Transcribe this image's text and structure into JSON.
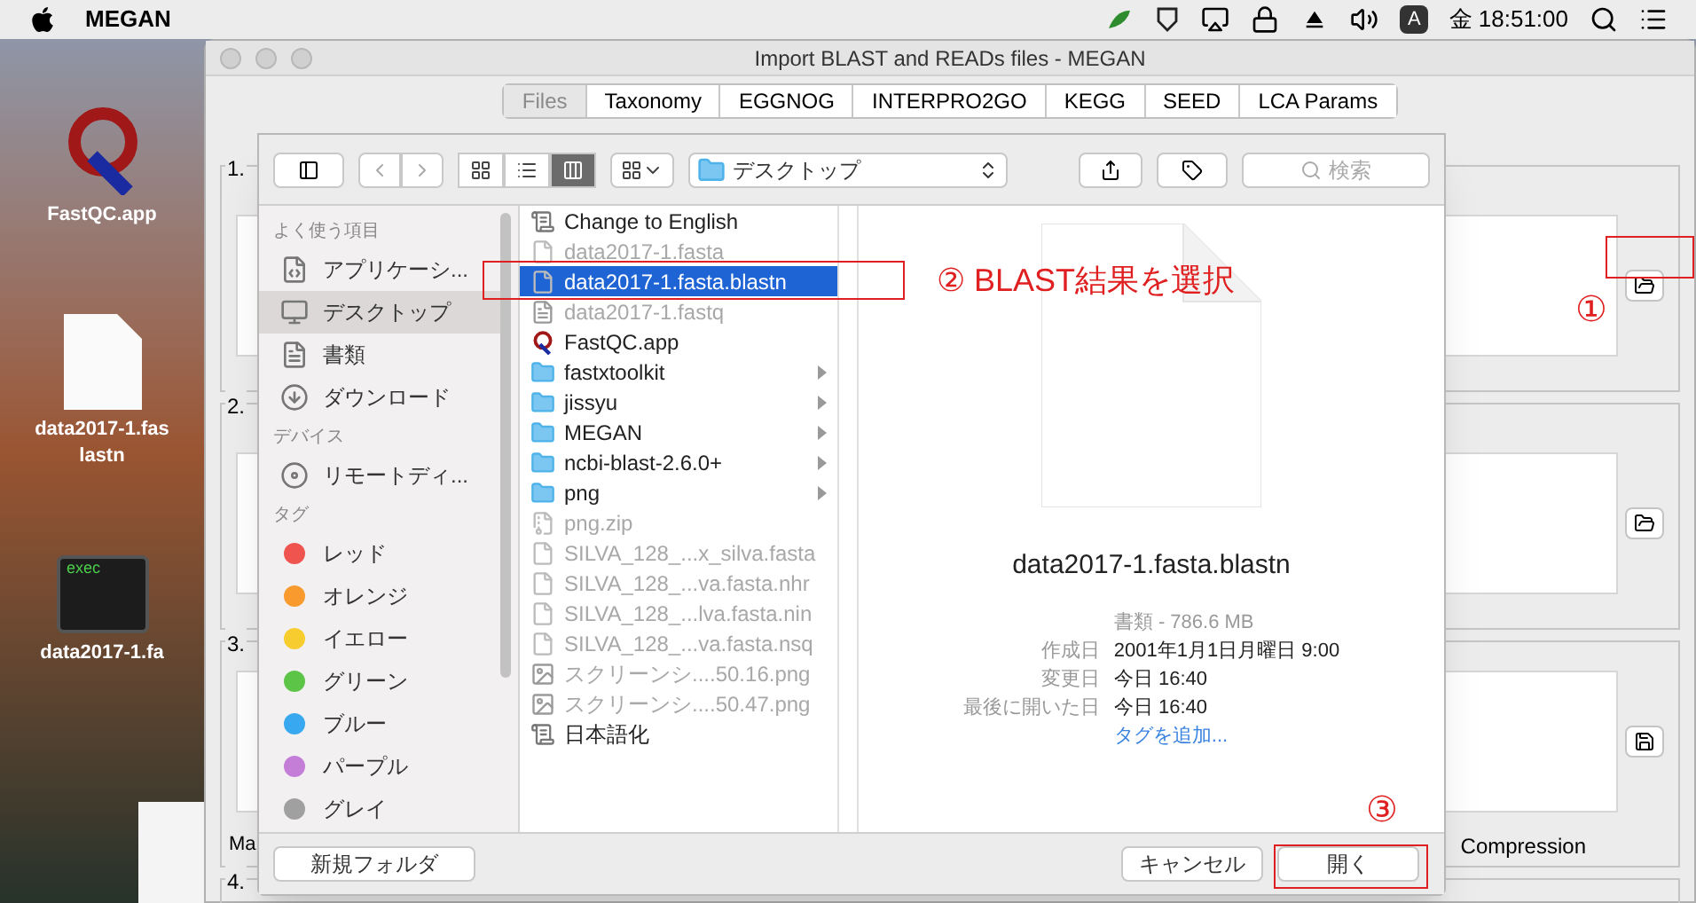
{
  "menu_bar": {
    "app": "MEGAN",
    "input_badge": "A",
    "clock": "金 18:51:00"
  },
  "desktop_icons": [
    {
      "kind": "app",
      "lines": [
        "FastQC.app"
      ]
    },
    {
      "kind": "document",
      "lines": [
        "data2017-1.fas",
        "lastn"
      ]
    },
    {
      "kind": "terminal",
      "badge": "exec",
      "lines": [
        "data2017-1.fa"
      ]
    }
  ],
  "window": {
    "title": "Import BLAST and READs files - MEGAN",
    "tabs": [
      {
        "label": "Files",
        "selected": true
      },
      {
        "label": "Taxonomy",
        "selected": false
      },
      {
        "label": "EGGNOG",
        "selected": false
      },
      {
        "label": "INTERPRO2GO",
        "selected": false
      },
      {
        "label": "KEGG",
        "selected": false
      },
      {
        "label": "SEED",
        "selected": false
      },
      {
        "label": "LCA Params",
        "selected": false
      }
    ],
    "sections": [
      {
        "number": "1.",
        "kind": "folder"
      },
      {
        "number": "2.",
        "kind": "folder"
      },
      {
        "number": "3.",
        "kind": "save",
        "left_text": "Ma",
        "right_text": "Compression"
      },
      {
        "number": "4.",
        "kind": "none"
      }
    ]
  },
  "dialog": {
    "location": "デスクトップ",
    "search": {
      "placeholder": "検索"
    },
    "view_modes": [
      {
        "kind": "icons",
        "selected": false
      },
      {
        "kind": "list",
        "selected": false
      },
      {
        "kind": "columns",
        "selected": true
      }
    ],
    "sidebar": [
      {
        "heading": "よく使う項目",
        "items": [
          {
            "kind": "apps",
            "label": "アプリケーシ...",
            "selected": false
          },
          {
            "kind": "desktop",
            "label": "デスクトップ",
            "selected": true
          },
          {
            "kind": "documents",
            "label": "書類",
            "selected": false
          },
          {
            "kind": "downloads",
            "label": "ダウンロード",
            "selected": false
          }
        ]
      },
      {
        "heading": "デバイス",
        "items": [
          {
            "kind": "disc",
            "label": "リモートディ...",
            "selected": false
          }
        ]
      },
      {
        "heading": "タグ",
        "items": [
          {
            "kind": "tag",
            "label": "レッド",
            "color": "#f0544f",
            "selected": false
          },
          {
            "kind": "tag",
            "label": "オレンジ",
            "color": "#f89a2e",
            "selected": false
          },
          {
            "kind": "tag",
            "label": "イエロー",
            "color": "#f7cc2f",
            "selected": false
          },
          {
            "kind": "tag",
            "label": "グリーン",
            "color": "#5cc446",
            "selected": false
          },
          {
            "kind": "tag",
            "label": "ブルー",
            "color": "#38a8f0",
            "selected": false
          },
          {
            "kind": "tag",
            "label": "パープル",
            "color": "#c47ed8",
            "selected": false
          },
          {
            "kind": "tag",
            "label": "グレイ",
            "color": "#a0a0a0",
            "selected": false
          }
        ]
      }
    ],
    "files": [
      {
        "name": "Change to English",
        "kind": "script",
        "dimmed": false,
        "selected": false
      },
      {
        "name": "data2017-1.fasta",
        "kind": "document",
        "dimmed": true,
        "selected": false
      },
      {
        "name": "data2017-1.fasta.blastn",
        "kind": "document",
        "dimmed": false,
        "selected": true
      },
      {
        "name": "data2017-1.fastq",
        "kind": "binary",
        "dimmed": true,
        "selected": false
      },
      {
        "name": "FastQC.app",
        "kind": "app",
        "dimmed": false,
        "selected": false
      },
      {
        "name": "fastxtoolkit",
        "kind": "folder",
        "dimmed": false,
        "selected": false
      },
      {
        "name": "jissyu",
        "kind": "folder",
        "dimmed": false,
        "selected": false
      },
      {
        "name": "MEGAN",
        "kind": "folder",
        "dimmed": false,
        "selected": false
      },
      {
        "name": "ncbi-blast-2.6.0+",
        "kind": "folder",
        "dimmed": false,
        "selected": false
      },
      {
        "name": "png",
        "kind": "folder",
        "dimmed": false,
        "selected": false
      },
      {
        "name": "png.zip",
        "kind": "archive",
        "dimmed": true,
        "selected": false
      },
      {
        "name": "SILVA_128_...x_silva.fasta",
        "kind": "document",
        "dimmed": true,
        "selected": false
      },
      {
        "name": "SILVA_128_...va.fasta.nhr",
        "kind": "document",
        "dimmed": true,
        "selected": false
      },
      {
        "name": "SILVA_128_...lva.fasta.nin",
        "kind": "document",
        "dimmed": true,
        "selected": false
      },
      {
        "name": "SILVA_128_...va.fasta.nsq",
        "kind": "document",
        "dimmed": true,
        "selected": false
      },
      {
        "name": "スクリーンシ....50.16.png",
        "kind": "image",
        "dimmed": true,
        "selected": false
      },
      {
        "name": "スクリーンシ....50.47.png",
        "kind": "image",
        "dimmed": true,
        "selected": false
      },
      {
        "name": "日本語化",
        "kind": "script",
        "dimmed": false,
        "selected": false
      }
    ],
    "preview": {
      "name": "data2017-1.fasta.blastn",
      "kind_size": "書類 - 786.6 MB",
      "info": [
        {
          "label": "作成日",
          "value": "2001年1月1日月曜日 9:00"
        },
        {
          "label": "変更日",
          "value": "今日 16:40"
        },
        {
          "label": "最後に開いた日",
          "value": "今日 16:40"
        }
      ],
      "add_tag": "タグを追加..."
    },
    "buttons": {
      "new_folder": "新規フォルダ",
      "cancel": "キャンセル",
      "open": "開く"
    }
  },
  "annotations": {
    "step1": "①",
    "step2": "② BLAST結果を選択",
    "step3": "③"
  }
}
